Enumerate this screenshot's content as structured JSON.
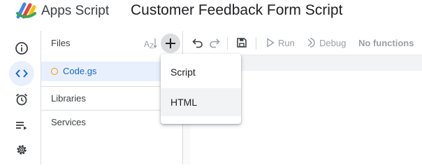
{
  "header": {
    "app_name": "Apps Script",
    "project_title": "Customer Feedback Form Script"
  },
  "rail": {
    "items": [
      {
        "icon": "info-icon",
        "active": false
      },
      {
        "icon": "code-icon",
        "active": true
      },
      {
        "icon": "alarm-clock-icon",
        "active": false
      },
      {
        "icon": "executions-list-icon",
        "active": false
      },
      {
        "icon": "gear-icon",
        "active": false
      }
    ]
  },
  "files_panel": {
    "title": "Files",
    "sort_icon": "sort-az-icon",
    "add_icon": "plus-icon",
    "files": [
      {
        "name": "Code.gs"
      }
    ],
    "sections": [
      {
        "label": "Libraries"
      },
      {
        "label": "Services"
      }
    ]
  },
  "toolbar": {
    "undo_icon": "undo-icon",
    "redo_icon": "redo-icon",
    "save_icon": "save-icon",
    "run_label": "Run",
    "debug_label": "Debug",
    "function_select": "No functions"
  },
  "add_menu": {
    "items": [
      {
        "label": "Script",
        "highlighted": false
      },
      {
        "label": "HTML",
        "highlighted": true
      }
    ]
  },
  "colors": {
    "accent_blue": "#1967d2",
    "active_bg": "#e8f0fe",
    "file_dot": "#f29900"
  }
}
